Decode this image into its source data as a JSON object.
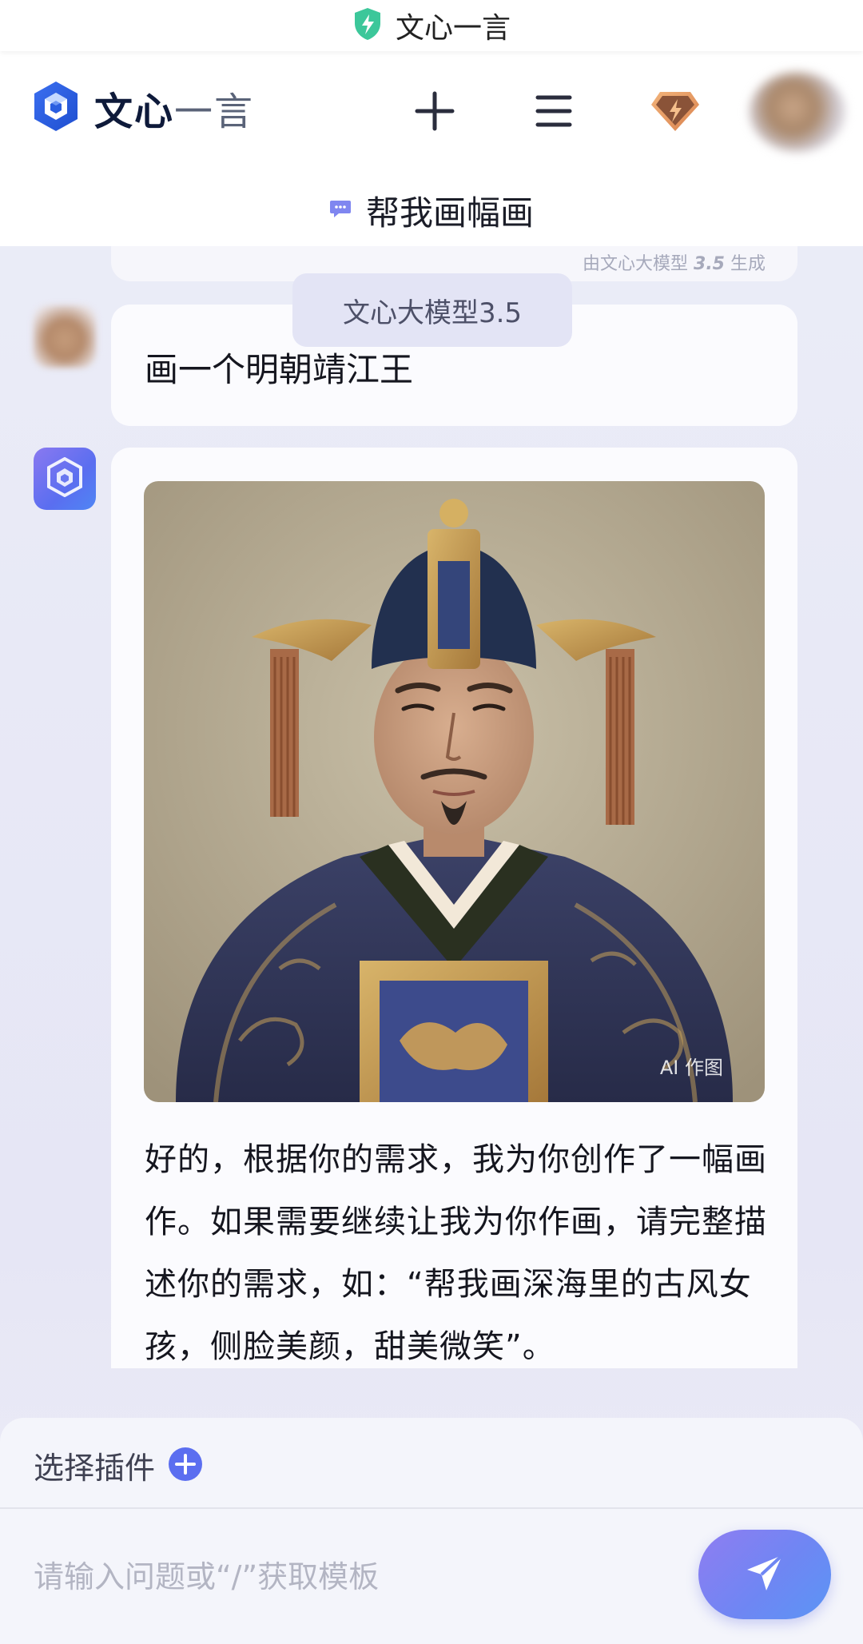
{
  "browser": {
    "tab_title": "文心一言",
    "icon": "shield-bolt-icon"
  },
  "header": {
    "logo_text_bold": "文心",
    "logo_text_light": "一言",
    "new_chat_icon": "plus-icon",
    "menu_icon": "hamburger-menu-icon",
    "vip_icon": "diamond-bolt-icon",
    "chat_title": "帮我画幅画",
    "chat_icon": "chat-bubble-icon"
  },
  "previous_message": {
    "generated_note_prefix": "由文心大模型 ",
    "generated_note_version": "3.5",
    "generated_note_suffix": " 生成"
  },
  "model_badge": "文心大模型3.5",
  "user_message": {
    "text": "画一个明朝靖江王"
  },
  "bot_message": {
    "image_tag": "AI 作图",
    "image_alt": "明朝靖江王画像",
    "text": "好的，根据你的需求，我为你创作了一幅画作。如果需要继续让我为你作画，请完整描述你的需求，如：“帮我画深海里的古风女孩，侧脸美颜，甜美微笑”。"
  },
  "composer": {
    "plugin_label": "选择插件",
    "plugin_icon": "plus-circle-icon",
    "input_placeholder": "请输入问题或“/”获取模板",
    "send_icon": "paper-plane-icon"
  },
  "colors": {
    "accent": "#5b6ef0",
    "gradient_start": "#8f7df2",
    "gradient_end": "#5b95f5"
  }
}
